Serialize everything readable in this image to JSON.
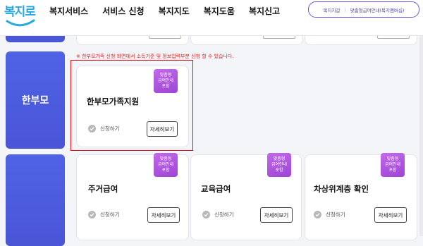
{
  "header": {
    "logo_text": "복지로",
    "nav": [
      "복지서비스",
      "서비스 신청",
      "복지지도",
      "복지도움",
      "복지신고"
    ],
    "pill_left": "복지지갑",
    "pill_right": "맞춤형급여안내(복지멤버십)"
  },
  "notice": "※ 한부모가족 신청 화면에서 소득기준 및 정보입력부분 신청 할 수 있습니다.",
  "sections": {
    "single_parent": {
      "label": "한부모",
      "cards": [
        {
          "title": "한부모가족지원",
          "badge": [
            "맞춤형",
            "급여안내",
            "포함"
          ],
          "status": "신청하기",
          "button": "자세히보기"
        }
      ]
    },
    "basic": {
      "cards": [
        {
          "title": "주거급여",
          "badge": [
            "맞춤형",
            "급여안내",
            "포함"
          ],
          "status": "신청하기",
          "button": "자세히보기"
        },
        {
          "title": "교육급여",
          "badge": [
            "맞춤형",
            "급여안내",
            "포함"
          ],
          "status": "신청하기",
          "button": "자세히보기"
        },
        {
          "title": "차상위계층 확인",
          "badge": [
            "맞춤형",
            "급여안내",
            "포함"
          ],
          "status": "신청하기",
          "button": "자세히보기"
        }
      ]
    }
  },
  "colors": {
    "side_block": "#4f5de0",
    "badge": "#b05ae0",
    "highlight": "#e01010",
    "notice": "#dd2222",
    "pill_border": "#6a5ad6"
  }
}
